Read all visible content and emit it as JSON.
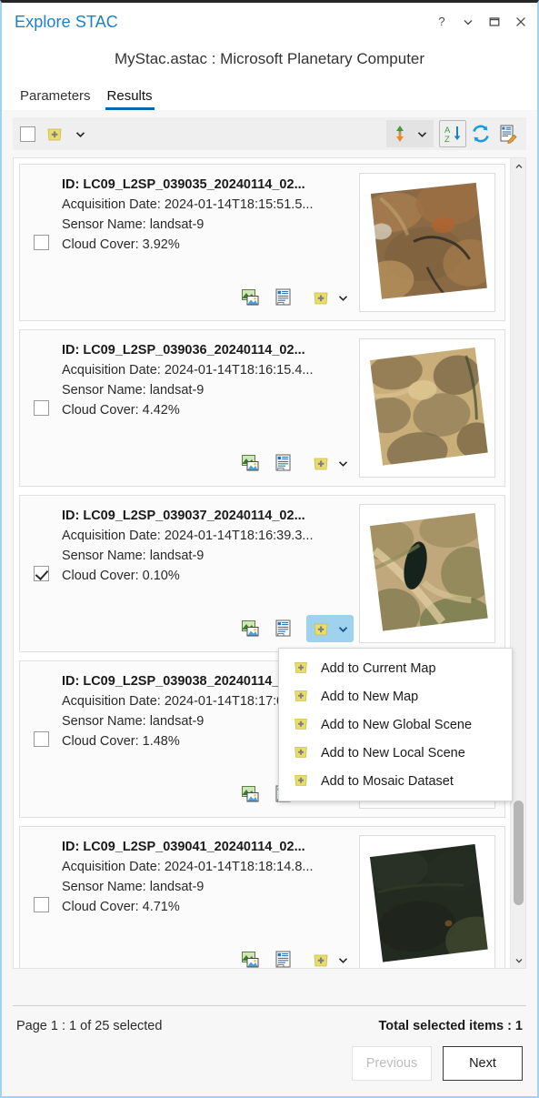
{
  "window": {
    "title": "Explore STAC",
    "controls": [
      {
        "name": "help-icon",
        "glyph": "?"
      },
      {
        "name": "chevron-down-icon",
        "glyph": "⌄"
      },
      {
        "name": "maximize-icon",
        "glyph": "□"
      },
      {
        "name": "close-icon",
        "glyph": "✕"
      }
    ]
  },
  "header": {
    "subtitle": "MyStac.astac : Microsoft Planetary Computer",
    "tabs": [
      {
        "label": "Parameters",
        "active": false
      },
      {
        "label": "Results",
        "active": true
      }
    ]
  },
  "toolbar": {
    "select_all_checked": false,
    "add_label": "add-to-map",
    "icons": [
      {
        "name": "select-all-checkbox"
      },
      {
        "name": "add-to-map-icon"
      },
      {
        "name": "add-to-map-dropdown-chevron-icon"
      },
      {
        "name": "sort-direction-icon"
      },
      {
        "name": "sort-direction-chevron-icon"
      },
      {
        "name": "sort-az-icon"
      },
      {
        "name": "refresh-icon"
      },
      {
        "name": "edit-metadata-icon"
      }
    ]
  },
  "results": {
    "labels": {
      "id_prefix": "ID: ",
      "acquisition_prefix": "Acquisition Date: ",
      "sensor_prefix": "Sensor Name: ",
      "cloud_prefix": "Cloud Cover: "
    },
    "items": [
      {
        "id": "ID: LC09_L2SP_039035_20240114_02...",
        "acquisition": "Acquisition Date: 2024-01-14T18:15:51.5...",
        "sensor": "Sensor Name: landsat-9",
        "cloud": "Cloud Cover: 3.92%",
        "selected": false,
        "menu_open": false,
        "thumb": {
          "base": "#8a6a45",
          "mid": "#a67d4e",
          "dark": "#4d3b27",
          "light": "#c79e64",
          "rotate": -6
        }
      },
      {
        "id": "ID: LC09_L2SP_039036_20240114_02...",
        "acquisition": "Acquisition Date: 2024-01-14T18:16:15.4...",
        "sensor": "Sensor Name: landsat-9",
        "cloud": "Cloud Cover: 4.42%",
        "selected": false,
        "menu_open": false,
        "thumb": {
          "base": "#b59a68",
          "mid": "#9a8052",
          "dark": "#6b5738",
          "light": "#ddc28c",
          "rotate": -7
        }
      },
      {
        "id": "ID: LC09_L2SP_039037_20240114_02...",
        "acquisition": "Acquisition Date: 2024-01-14T18:16:39.3...",
        "sensor": "Sensor Name: landsat-9",
        "cloud": "Cloud Cover: 0.10%",
        "selected": true,
        "menu_open": true,
        "thumb": {
          "base": "#b49f74",
          "mid": "#8e7d52",
          "dark": "#3d3a24",
          "light": "#d6c295",
          "rotate": -7
        }
      },
      {
        "id": "ID: LC09_L2SP_039038_20240114_02...",
        "acquisition": "Acquisition Date: 2024-01-14T18:17:03.2...",
        "sensor": "Sensor Name: landsat-9",
        "cloud": "Cloud Cover: 1.48%",
        "selected": false,
        "menu_open": false,
        "thumb": {
          "base": "#3a3a2a",
          "mid": "#55512f",
          "dark": "#23231a",
          "light": "#7d7448",
          "rotate": -7
        }
      },
      {
        "id": "ID: LC09_L2SP_039041_20240114_02...",
        "acquisition": "Acquisition Date: 2024-01-14T18:18:14.8...",
        "sensor": "Sensor Name: landsat-9",
        "cloud": "Cloud Cover: 4.71%",
        "selected": false,
        "menu_open": false,
        "thumb": {
          "base": "#23281f",
          "mid": "#2c3326",
          "dark": "#171b14",
          "light": "#4d5535",
          "rotate": -7
        }
      }
    ]
  },
  "context_menu": {
    "items": [
      {
        "label": "Add to Current  Map",
        "icon": "add-to-map-icon"
      },
      {
        "label": "Add to New Map",
        "icon": "add-to-map-icon"
      },
      {
        "label": "Add to New Global Scene",
        "icon": "add-to-map-icon"
      },
      {
        "label": "Add to New Local Scene",
        "icon": "add-to-map-icon"
      },
      {
        "label": "Add to Mosaic Dataset",
        "icon": "add-to-map-icon"
      }
    ]
  },
  "footer": {
    "page_status": "Page 1 : 1 of 25 selected",
    "total_selected": "Total selected items : 1",
    "previous_label": "Previous",
    "next_label": "Next"
  },
  "colors": {
    "accent": "#1a82c4",
    "tab_underline": "#0a69a8",
    "highlight": "#9fd2ef",
    "yellow": "#e8dd6a"
  }
}
